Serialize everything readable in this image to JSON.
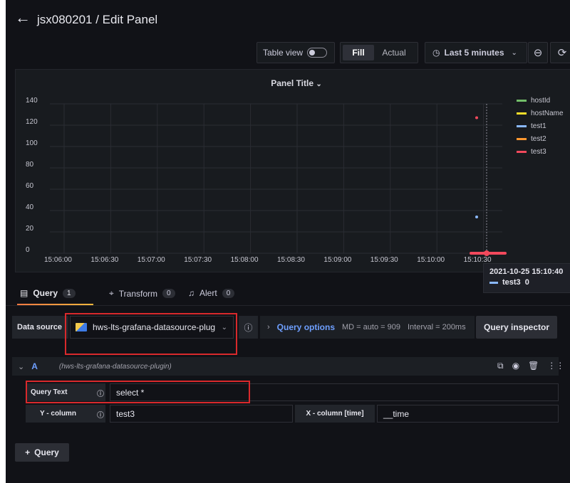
{
  "header": {
    "title": "jsx080201 / Edit Panel"
  },
  "toolbar": {
    "table_view_label": "Table view",
    "fill_label": "Fill",
    "actual_label": "Actual",
    "time_range_label": "Last 5 minutes"
  },
  "panel": {
    "title": "Panel Title"
  },
  "chart_data": {
    "type": "scatter",
    "title": "Panel Title",
    "x_tick_labels": [
      "15:06:00",
      "15:06:30",
      "15:07:00",
      "15:07:30",
      "15:08:00",
      "15:08:30",
      "15:09:00",
      "15:09:30",
      "15:10:00",
      "15:10:30"
    ],
    "y_tick_labels": [
      "0",
      "20",
      "40",
      "60",
      "80",
      "100",
      "120",
      "140"
    ],
    "ylim": [
      0,
      140
    ],
    "grid": true,
    "legend_placement": "right",
    "series": [
      {
        "name": "hostId",
        "color": "#73bf69",
        "points": []
      },
      {
        "name": "hostName",
        "color": "#fade2a",
        "points": []
      },
      {
        "name": "test1",
        "color": "#8ab8ff",
        "points": [
          {
            "x": "15:10:40",
            "y": 34
          }
        ]
      },
      {
        "name": "test2",
        "color": "#ff9830",
        "points": []
      },
      {
        "name": "test3",
        "color": "#f2495c",
        "points": [
          {
            "x": "15:10:40",
            "y": 127
          },
          {
            "x": "15:10:40",
            "y": 0
          }
        ]
      }
    ]
  },
  "tooltip": {
    "time": "2021-10-25 15:10:40",
    "series": "test3",
    "value": "0"
  },
  "tabs": [
    {
      "label": "Query",
      "count": "1"
    },
    {
      "label": "Transform",
      "count": "0"
    },
    {
      "label": "Alert",
      "count": "0"
    }
  ],
  "query_row": {
    "datasource_label": "Data source",
    "datasource_value": "hws-lts-grafana-datasource-plug",
    "query_options_label": "Query options",
    "md_text": "MD = auto = 909",
    "interval_text": "Interval = 200ms",
    "query_inspector_label": "Query inspector"
  },
  "query_a": {
    "letter": "A",
    "source": "(hws-lts-grafana-datasource-plugin)",
    "query_text_label": "Query Text",
    "query_text_value": "select *",
    "y_column_label": "Y - column",
    "y_column_value": "test3",
    "x_column_label": "X - column [time]",
    "x_column_value": "__time"
  },
  "add_query_label": "Query"
}
